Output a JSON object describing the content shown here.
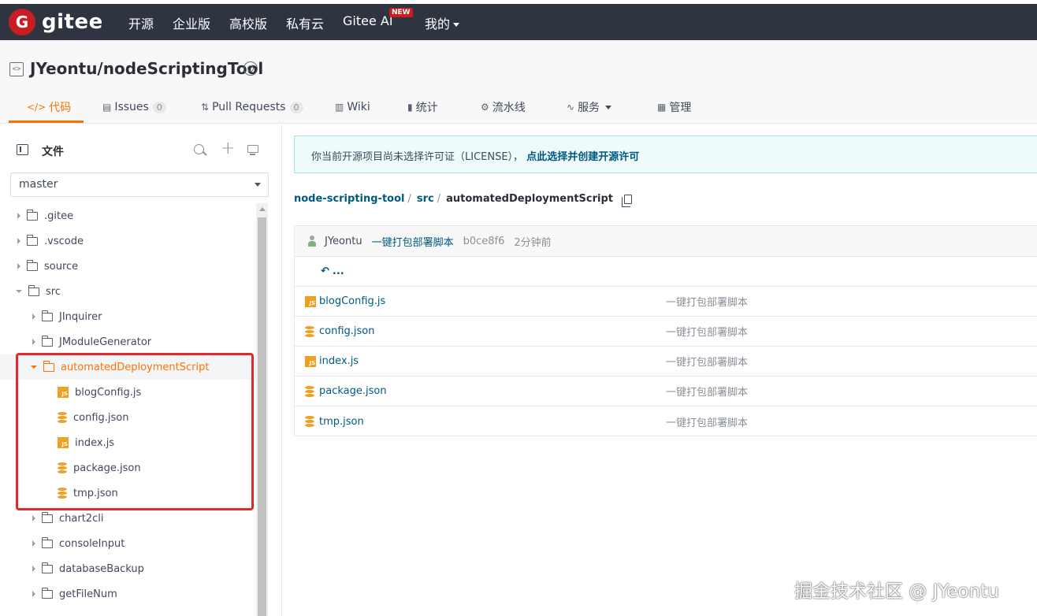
{
  "topnav": {
    "logo_letter": "G",
    "logo_text": "gitee",
    "items": [
      "开源",
      "企业版",
      "高校版",
      "私有云",
      "Gitee AI",
      "我的"
    ],
    "new_badge": "NEW"
  },
  "repo": {
    "title": "JYeontu/nodeScriptingTool",
    "tabs": [
      {
        "icon": "</>",
        "label": "代码"
      },
      {
        "icon": "▤",
        "label": "Issues",
        "count": "0"
      },
      {
        "icon": "⇅",
        "label": "Pull Requests",
        "count": "0"
      },
      {
        "icon": "▥",
        "label": "Wiki"
      },
      {
        "icon": "▮",
        "label": "统计"
      },
      {
        "icon": "⚙",
        "label": "流水线"
      },
      {
        "icon": "∿",
        "label": "服务"
      },
      {
        "icon": "▦",
        "label": "管理"
      }
    ]
  },
  "sidebar": {
    "title": "文件",
    "branch": "master",
    "tree": [
      {
        "name": ".gitee",
        "type": "folder"
      },
      {
        "name": ".vscode",
        "type": "folder"
      },
      {
        "name": "source",
        "type": "folder"
      },
      {
        "name": "src",
        "type": "folder"
      },
      {
        "name": "JInquirer",
        "type": "folder"
      },
      {
        "name": "JModuleGenerator",
        "type": "folder"
      },
      {
        "name": "automatedDeploymentScript",
        "type": "folder"
      },
      {
        "name": "blogConfig.js",
        "type": "js"
      },
      {
        "name": "config.json",
        "type": "json"
      },
      {
        "name": "index.js",
        "type": "js"
      },
      {
        "name": "package.json",
        "type": "json"
      },
      {
        "name": "tmp.json",
        "type": "json"
      },
      {
        "name": "chart2cli",
        "type": "folder"
      },
      {
        "name": "consoleInput",
        "type": "folder"
      },
      {
        "name": "databaseBackup",
        "type": "folder"
      },
      {
        "name": "getFileNum",
        "type": "folder"
      }
    ]
  },
  "main": {
    "license_text": "你当前开源项目尚未选择许可证（LICENSE），",
    "license_link": "点此选择并创建开源许可",
    "breadcrumb": [
      "node-scripting-tool",
      "src",
      "automatedDeploymentScript"
    ],
    "commit": {
      "author": "JYeontu",
      "message": "一键打包部署脚本",
      "hash": "b0ce8f6",
      "time": "2分钟前"
    },
    "parent_label": "...",
    "files": [
      {
        "name": "blogConfig.js",
        "type": "js",
        "message": "一键打包部署脚本"
      },
      {
        "name": "config.json",
        "type": "json",
        "message": "一键打包部署脚本"
      },
      {
        "name": "index.js",
        "type": "js",
        "message": "一键打包部署脚本"
      },
      {
        "name": "package.json",
        "type": "json",
        "message": "一键打包部署脚本"
      },
      {
        "name": "tmp.json",
        "type": "json",
        "message": "一键打包部署脚本"
      }
    ]
  },
  "watermark": "掘金技术社区 @ JYeontu",
  "colors": {
    "accent": "#fe7300",
    "nav_bg": "#2e3440",
    "link": "#005980",
    "highlight": "#e0282e",
    "js_icon": "#f0a020"
  }
}
